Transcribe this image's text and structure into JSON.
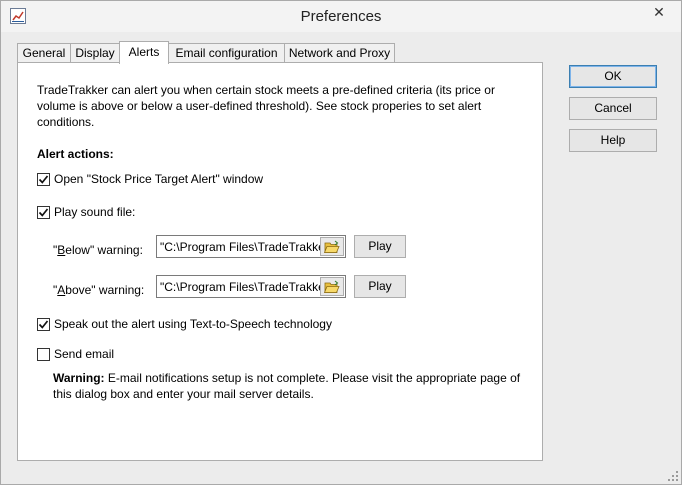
{
  "window": {
    "title": "Preferences",
    "close_glyph": "✕"
  },
  "tabs": [
    {
      "label": "General"
    },
    {
      "label": "Display"
    },
    {
      "label": "Alerts"
    },
    {
      "label": "Email configuration"
    },
    {
      "label": "Network and Proxy"
    }
  ],
  "active_tab": "Alerts",
  "alerts": {
    "intro": "TradeTrakker can alert you when certain stock meets a pre-defined criteria (its price or volume is above or below a user-defined threshold). See stock properies to set alert conditions.",
    "section_title": "Alert actions:",
    "open_window": {
      "label": "Open \"Stock Price Target Alert\" window",
      "checked": true
    },
    "play_sound": {
      "label": "Play sound file:",
      "checked": true
    },
    "below": {
      "label_prefix": "\"",
      "label_mnemonic": "B",
      "label_rest": "elow\" warning:",
      "path": "\"C:\\Program Files\\TradeTrakker",
      "play_label": "Play"
    },
    "above": {
      "label_prefix": "\"",
      "label_mnemonic": "A",
      "label_rest": "bove\" warning:",
      "path": "\"C:\\Program Files\\TradeTrakker",
      "play_label": "Play"
    },
    "speak": {
      "label": "Speak out the alert using Text-to-Speech technology",
      "checked": true
    },
    "send_email": {
      "label": "Send email",
      "checked": false
    },
    "warning_bold": "Warning:",
    "warning_text": " E-mail notifications setup is not complete. Please visit the appropriate page of this dialog box and enter your mail server details."
  },
  "buttons": {
    "ok": "OK",
    "cancel": "Cancel",
    "help": "Help"
  },
  "icons": {
    "browse": "folder-open-icon",
    "check": "checkmark-icon"
  }
}
